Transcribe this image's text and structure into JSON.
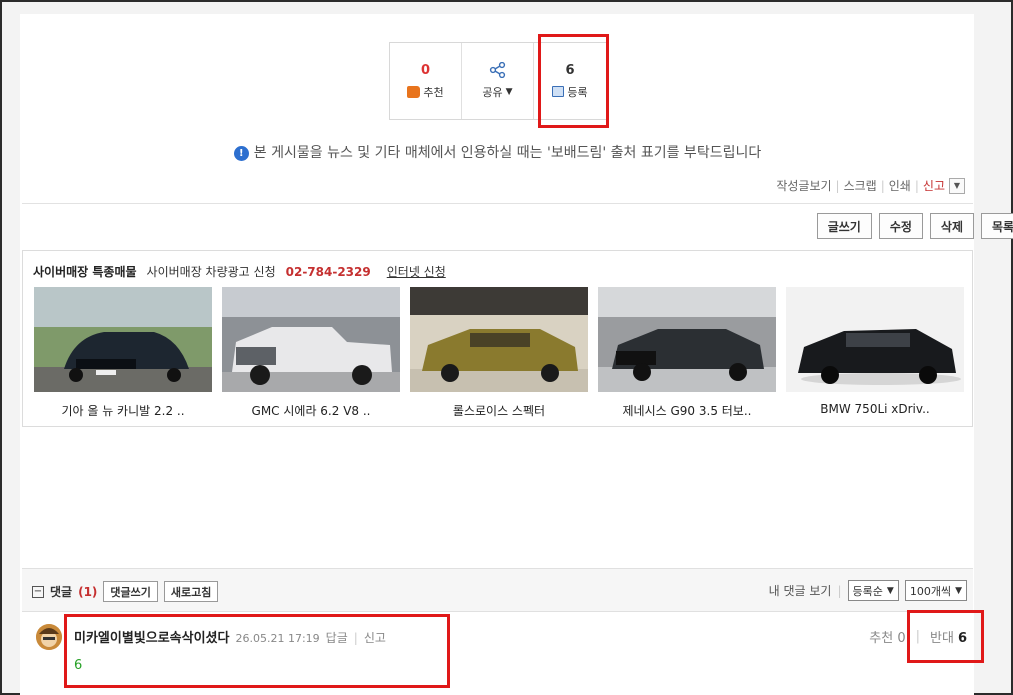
{
  "actions": {
    "recommend": {
      "count": "0",
      "label": "추천"
    },
    "share": {
      "label": "공유"
    },
    "register": {
      "count": "6",
      "label": "등록"
    }
  },
  "notice": "본 게시물을 뉴스 및 기타 매체에서 인용하실 때는 '보배드림' 출처 표기를 부탁드립니다",
  "post_links": {
    "view_author": "작성글보기",
    "scrap": "스크랩",
    "print": "인쇄",
    "report": "신고"
  },
  "write_tools": {
    "write": "글쓰기",
    "edit": "수정",
    "delete": "삭제",
    "list": "목록"
  },
  "market": {
    "title": "사이버매장 특종매물",
    "subtitle": "사이버매장 차량광고 신청",
    "phone": "02-784-2329",
    "apply": "인터넷 신청",
    "cars": [
      {
        "name": "기아 올 뉴 카니발 2.2 ..",
        "color": "#1d2630"
      },
      {
        "name": "GMC 시에라 6.2 V8 ..",
        "color": "#e8e8ea"
      },
      {
        "name": "롤스로이스 스펙터",
        "color": "#8a7a2e"
      },
      {
        "name": "제네시스 G90 3.5 터보..",
        "color": "#2b2f33"
      },
      {
        "name": "BMW 750Li xDriv..",
        "color": "#181a1d"
      }
    ]
  },
  "comments": {
    "title": "댓글",
    "count": "(1)",
    "write_btn": "댓글쓰기",
    "refresh_btn": "새로고침",
    "my_comments": "내 댓글 보기",
    "sort": "등록순",
    "per_page": "100개씩",
    "items": [
      {
        "nick": "미카엘이별빛으로속삭이셨다",
        "date": "26.05.21 17:19",
        "reply": "답글",
        "report": "신고",
        "body": "6",
        "recommend_label": "추천",
        "recommend_count": "0",
        "against_label": "반대",
        "against_count": "6"
      }
    ]
  }
}
